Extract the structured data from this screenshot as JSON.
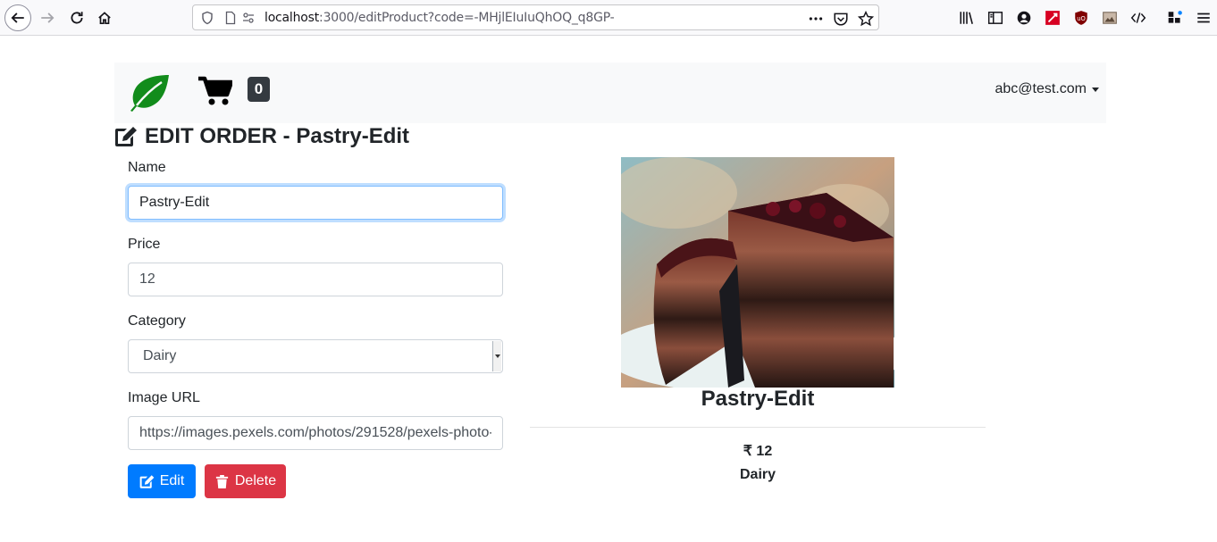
{
  "browser": {
    "url_host": "localhost",
    "url_path": ":3000/editProduct?code=-MHjlEIuIuQhOQ_q8GP-"
  },
  "navbar": {
    "cart_count": "0",
    "user_email": "abc@test.com"
  },
  "page": {
    "title": "EDIT ORDER - Pastry-Edit"
  },
  "form": {
    "name_label": "Name",
    "name_value": "Pastry-Edit",
    "price_label": "Price",
    "price_value": "12",
    "category_label": "Category",
    "category_value": "Dairy",
    "image_label": "Image URL",
    "image_value": "https://images.pexels.com/photos/291528/pexels-photo-",
    "edit_label": "Edit",
    "delete_label": "Delete"
  },
  "preview": {
    "name": "Pastry-Edit",
    "price": "12",
    "currency_symbol": "₹",
    "category": "Dairy"
  },
  "colors": {
    "primary": "#007bff",
    "danger": "#dc3545",
    "brand_leaf": "#128c1b"
  }
}
